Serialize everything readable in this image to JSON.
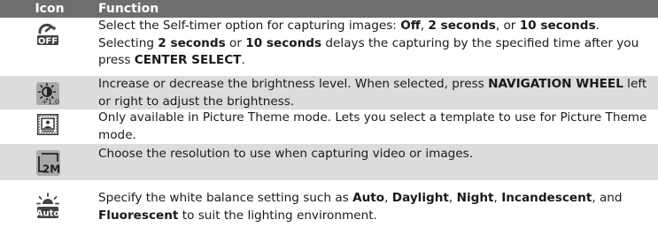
{
  "header": {
    "icon": "Icon",
    "function": "Function"
  },
  "rows": [
    {
      "icon": "self-timer-off-icon",
      "parts": [
        {
          "t": "Select the Self-timer option for capturing images: "
        },
        {
          "t": "Off",
          "b": true
        },
        {
          "t": ", "
        },
        {
          "t": "2 seconds",
          "b": true
        },
        {
          "t": ", or "
        },
        {
          "t": "10 seconds",
          "b": true
        },
        {
          "t": ". Selecting "
        },
        {
          "t": "2 seconds",
          "b": true
        },
        {
          "t": " or "
        },
        {
          "t": "10 seconds",
          "b": true
        },
        {
          "t": " delays the capturing by the specified time after you press "
        },
        {
          "t": "CENTER SELECT",
          "b": true
        },
        {
          "t": "."
        }
      ]
    },
    {
      "icon": "brightness-icon",
      "icon_label": "+1.0",
      "parts": [
        {
          "t": "Increase or decrease the brightness level. When selected, press "
        },
        {
          "t": "NAVIGATION WHEEL",
          "b": true
        },
        {
          "t": " left or right to adjust the brightness."
        }
      ]
    },
    {
      "icon": "picture-theme-icon",
      "parts": [
        {
          "t": "Only available in Picture Theme mode. Lets you select a template to use for Picture Theme mode."
        }
      ]
    },
    {
      "icon": "resolution-icon",
      "icon_label": "2M",
      "parts": [
        {
          "t": "Choose the resolution to use when capturing video or images."
        }
      ]
    },
    {
      "icon": "white-balance-auto-icon",
      "icon_label": "Auto",
      "parts": [
        {
          "t": "Specify the white balance setting such as "
        },
        {
          "t": "Auto",
          "b": true
        },
        {
          "t": ", "
        },
        {
          "t": "Daylight",
          "b": true
        },
        {
          "t": ", "
        },
        {
          "t": "Night",
          "b": true
        },
        {
          "t": ", "
        },
        {
          "t": "Incandescent",
          "b": true
        },
        {
          "t": ", and "
        },
        {
          "t": "Fluorescent",
          "b": true
        },
        {
          "t": " to suit the lighting environment."
        }
      ]
    }
  ]
}
